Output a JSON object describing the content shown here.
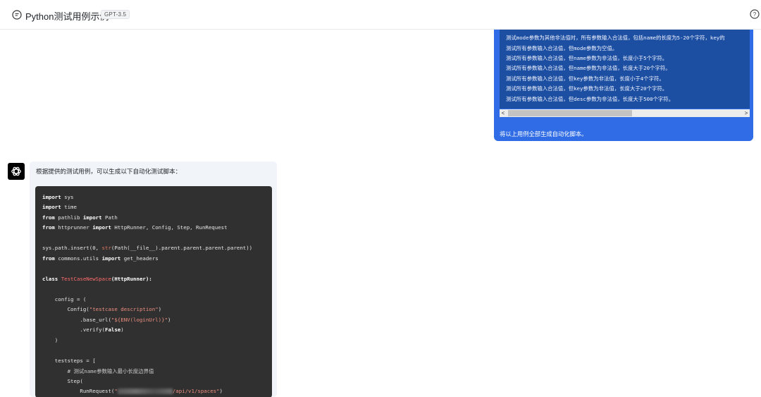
{
  "header": {
    "title": "Python测试用例示例",
    "model_badge": "GPT-3.5",
    "chat_icon": "chat-bubble-icon",
    "help_icon": "help-circle-icon"
  },
  "user_message": {
    "code_lines": [
      "测试mode参数为其他非法值时，所有参数输入合法值，包括name的长度为5-20个字符，key的",
      "测试所有参数输入合法值，但mode参数为空值。",
      "测试所有参数输入合法值，但name参数为非法值，长度小于5个字符。",
      "测试所有参数输入合法值，但name参数为非法值，长度大于20个字符。",
      "测试所有参数输入合法值，但key参数为非法值，长度小于4个字符。",
      "测试所有参数输入合法值，但key参数为非法值，长度大于20个字符。",
      "测试所有参数输入合法值，但desc参数为非法值，长度大于500个字符。"
    ],
    "text": "将以上用例全部生成自动化脚本。",
    "scroll_left": "<",
    "scroll_right": ">"
  },
  "assistant": {
    "avatar_icon": "openai-logo-icon",
    "intro": "根据提供的测试用例，可以生成以下自动化测试脚本：",
    "code": {
      "l1_kw": "import",
      "l1_rest": " sys",
      "l2_kw": "import",
      "l2_rest": " time",
      "l3_kw": "from",
      "l3_mid": " pathlib ",
      "l3_kw2": "import",
      "l3_rest": " Path",
      "l4_kw": "from",
      "l4_mid": " httprunner ",
      "l4_kw2": "import",
      "l4_rest": " HttpRunner, Config, Step, RunRequest",
      "l5_a": "sys.path.insert(0, ",
      "l5_fn": "str",
      "l5_b": "(Path(__file__).parent.parent.parent.parent))",
      "l6_kw": "from",
      "l6_mid": " commons.utils ",
      "l6_kw2": "import",
      "l6_rest": " get_headers",
      "l7_kw": "class",
      "l7_cls": " TestCaseNewSpace",
      "l7_rest": "(HttpRunner):",
      "l8": "    config = (",
      "l9_a": "        Config(",
      "l9_str": "\"testcase description\"",
      "l9_b": ")",
      "l10_a": "            .base_url(",
      "l10_str": "\"${ENV(loginUrl)}\"",
      "l10_b": ")",
      "l11_a": "            .verify(",
      "l11_kw": "False",
      "l11_b": ")",
      "l12": "    )",
      "l13": "    teststeps = [",
      "l14": "        # 测试name参数输入最小长度边界值",
      "l15": "        Step(",
      "l16_a": "            RunRequest(",
      "l16_str1": "\"",
      "l16_str2": "/api/v1/spaces\"",
      "l16_b": ")"
    }
  }
}
